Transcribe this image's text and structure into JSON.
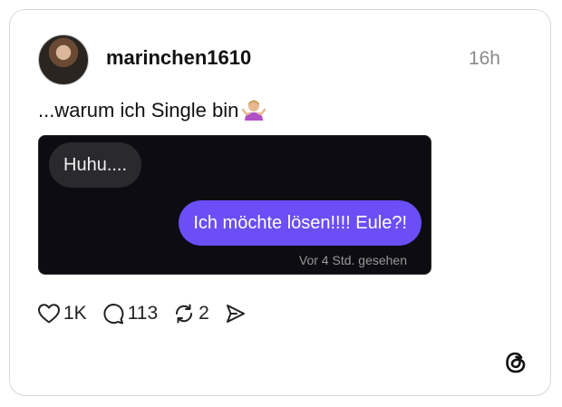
{
  "post": {
    "username": "marinchen1610",
    "timestamp": "16h",
    "caption": "...warum ich Single bin"
  },
  "chat": {
    "incoming_message": "Huhu....",
    "outgoing_message": "Ich möchte lösen!!!! Eule?!",
    "seen_status": "Vor 4 Std. gesehen"
  },
  "actions": {
    "likes": "1K",
    "replies": "113",
    "reposts": "2"
  },
  "icons": {
    "like": "heart-icon",
    "reply": "comment-icon",
    "repost": "repost-icon",
    "share": "send-icon",
    "brand": "threads-logo",
    "caption_emoji": "person-shrugging-emoji"
  },
  "colors": {
    "outgoing_bubble": "#6b4ef6",
    "incoming_bubble": "#2a2a2e",
    "chat_background": "#0c0c12"
  }
}
